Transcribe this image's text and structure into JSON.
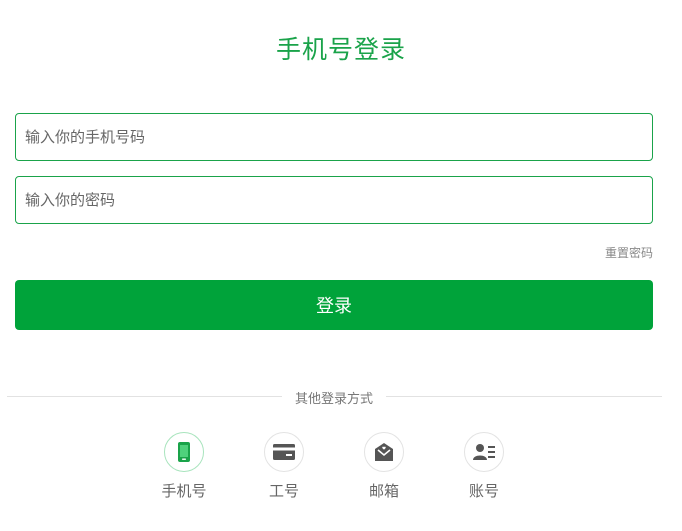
{
  "title": "手机号登录",
  "phone_field": {
    "placeholder": "输入你的手机号码",
    "value": ""
  },
  "password_field": {
    "placeholder": "输入你的密码",
    "value": ""
  },
  "reset_password_label": "重置密码",
  "login_button_label": "登录",
  "divider_label": "其他登录方式",
  "colors": {
    "accent": "#1aa34a",
    "button": "#00a33a",
    "icon_gray": "#555555"
  },
  "login_methods": [
    {
      "label": "手机号",
      "icon": "phone-icon",
      "active": true
    },
    {
      "label": "工号",
      "icon": "card-icon",
      "active": false
    },
    {
      "label": "邮箱",
      "icon": "mail-icon",
      "active": false
    },
    {
      "label": "账号",
      "icon": "user-account-icon",
      "active": false
    }
  ]
}
